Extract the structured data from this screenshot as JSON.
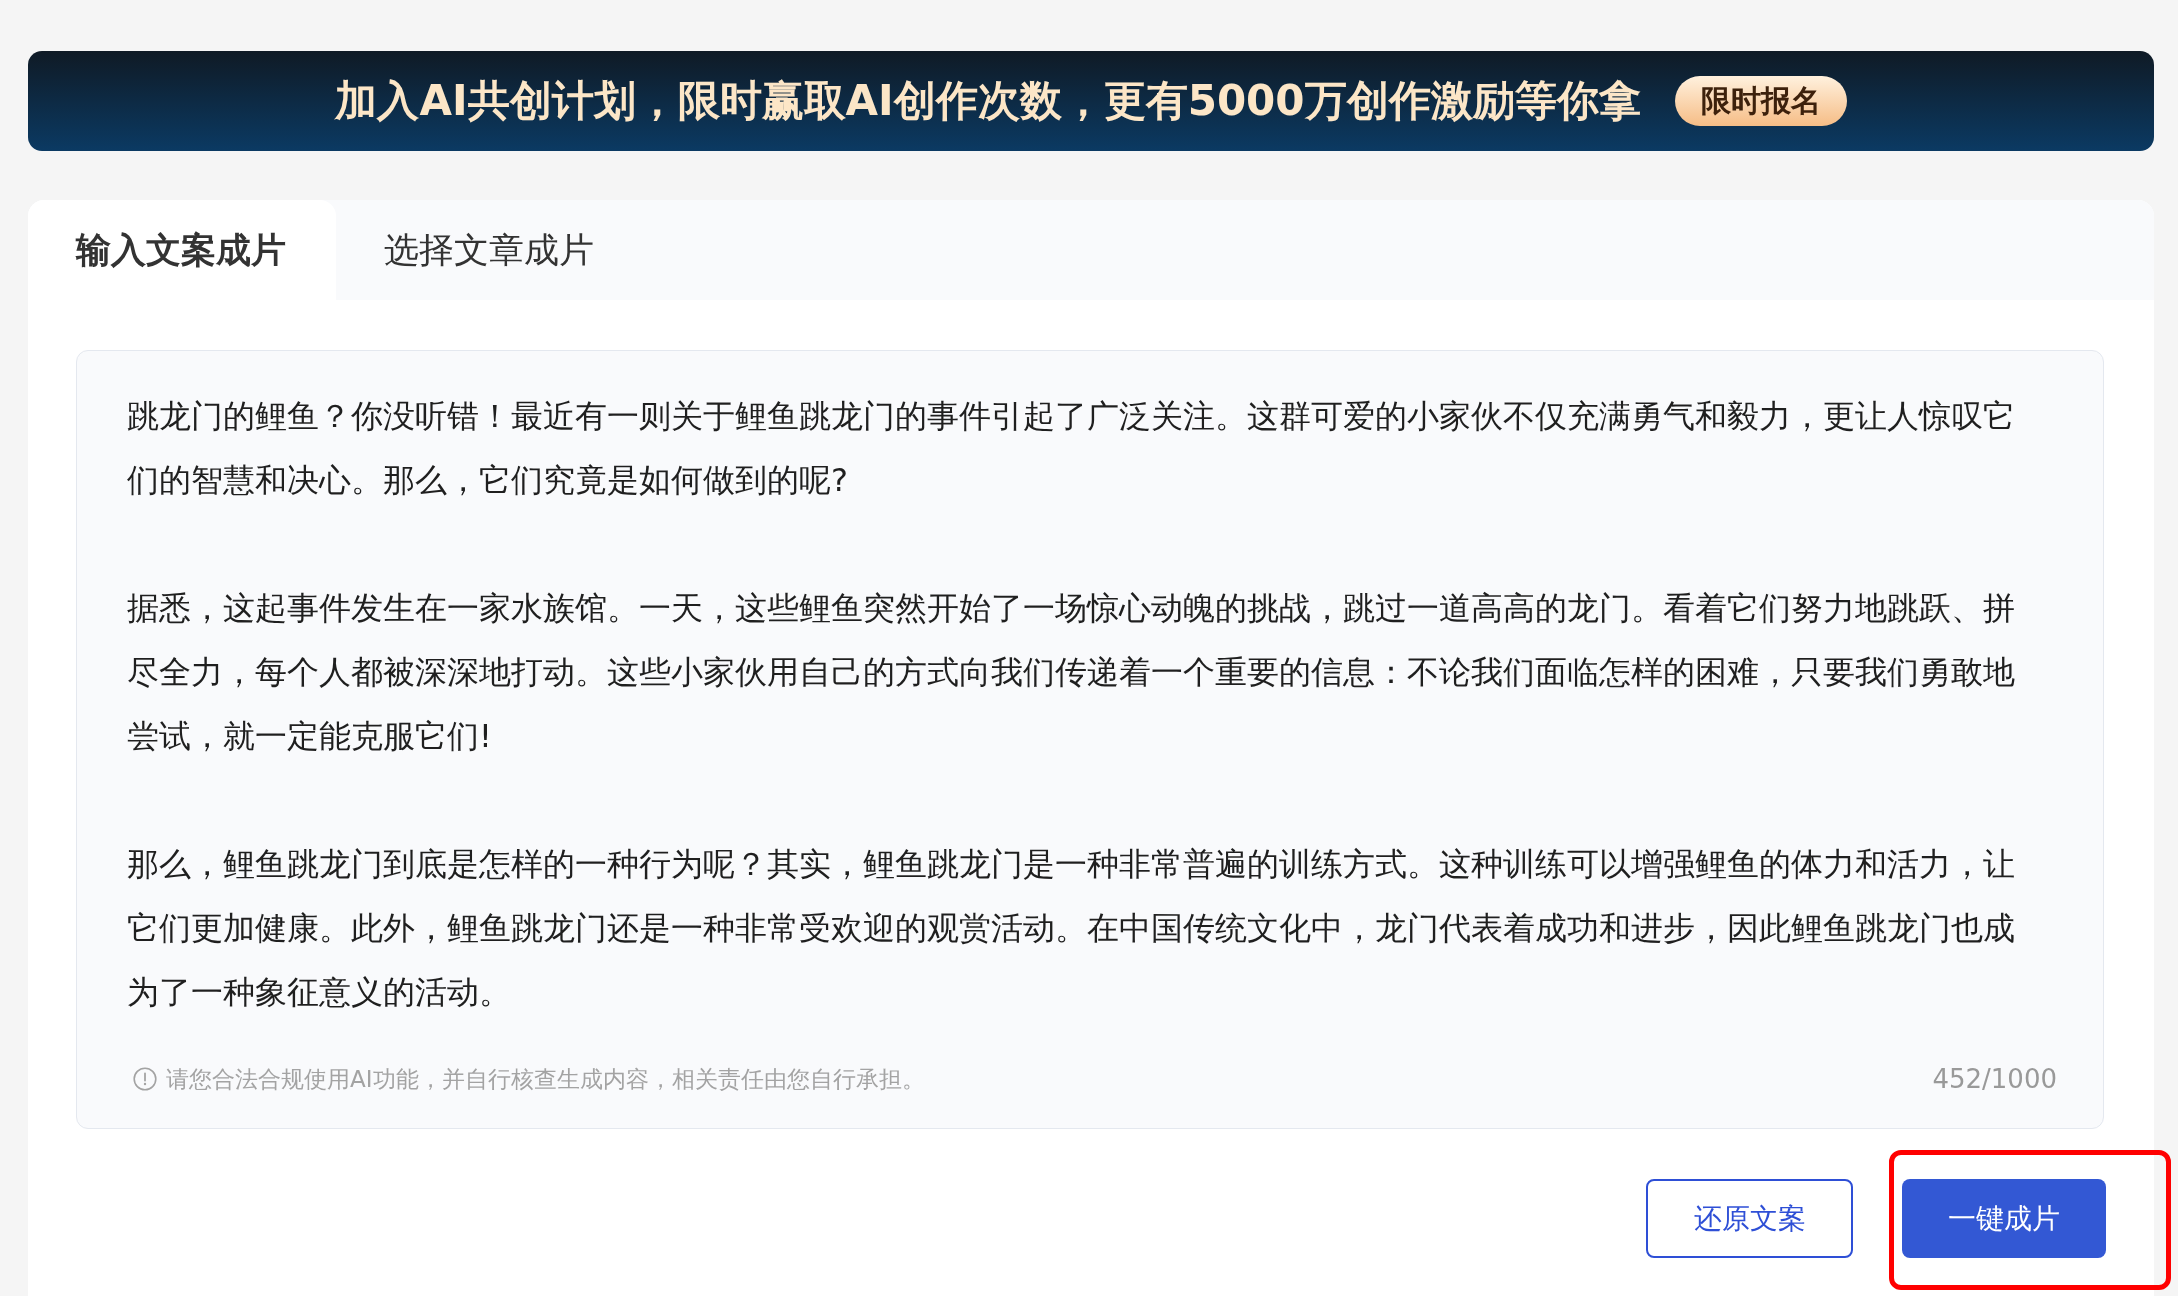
{
  "banner": {
    "text": "加入AI共创计划，限时赢取AI创作次数，更有5000万创作激励等你拿",
    "button": "限时报名"
  },
  "tabs": [
    {
      "label": "输入文案成片",
      "selected": true
    },
    {
      "label": "选择文章成片",
      "selected": false
    }
  ],
  "editor": {
    "value": [
      "跳龙门的鲤鱼？你没听错！最近有一则关于鲤鱼跳龙门的事件引起了广泛关注。这群可爱的小家伙不仅充满勇气和毅力，更让人惊叹它们的智慧和决心。那么，它们究竟是如何做到的呢?",
      "据悉，这起事件发生在一家水族馆。一天，这些鲤鱼突然开始了一场惊心动魄的挑战，跳过一道高高的龙门。看着它们努力地跳跃、拼尽全力，每个人都被深深地打动。这些小家伙用自己的方式向我们传递着一个重要的信息：不论我们面临怎样的困难，只要我们勇敢地尝试，就一定能克服它们!",
      "那么，鲤鱼跳龙门到底是怎样的一种行为呢？其实，鲤鱼跳龙门是一种非常普遍的训练方式。这种训练可以增强鲤鱼的体力和活力，让它们更加健康。此外，鲤鱼跳龙门还是一种非常受欢迎的观赏活动。在中国传统文化中，龙门代表着成功和进步，因此鲤鱼跳龙门也成为了一种象征意义的活动。"
    ],
    "notice": "请您合法合规使用AI功能，并自行核查生成内容，相关责任由您自行承担。",
    "counter": "452/1000"
  },
  "buttons": [
    {
      "label": "还原文案",
      "kind": "secondary",
      "highlighted": false
    },
    {
      "label": "一键成片",
      "kind": "primary",
      "highlighted": true
    }
  ]
}
